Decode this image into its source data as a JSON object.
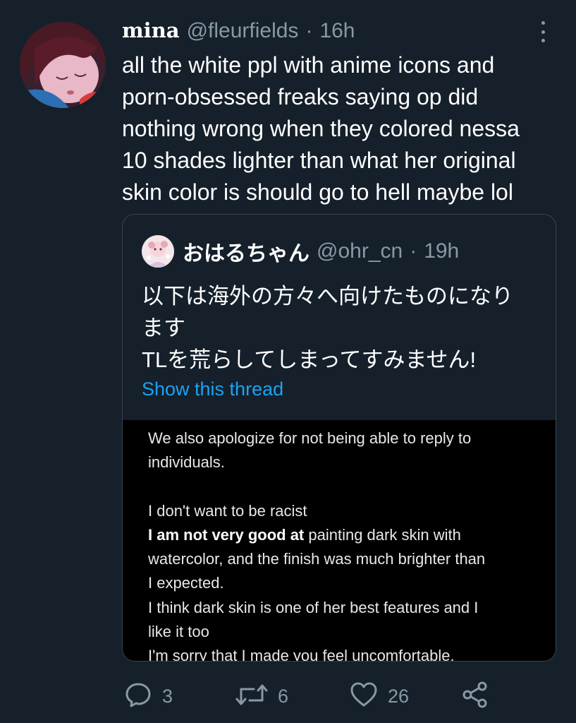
{
  "tweet": {
    "display_name": "mina",
    "handle": "@fleurfields",
    "separator": "·",
    "time": "16h",
    "text_lines": [
      "all the white ppl with anime icons and",
      "porn-obsessed freaks saying op did",
      "nothing wrong when they colored nessa",
      "10 shades lighter than what her original",
      "skin color is  should go to hell maybe lol"
    ]
  },
  "quoted_tweet": {
    "display_name": "おはるちゃん",
    "handle": "@ohr_cn",
    "separator": "·",
    "time": "19h",
    "text_lines": [
      "以下は海外の方々へ向けたものになり",
      "ます",
      "TLを荒らしてしまってすみません!"
    ],
    "show_thread": "Show this thread",
    "image_text": {
      "line1": "We also apologize for not being able to reply to",
      "line2": "individuals.",
      "line3": "",
      "line4": "I don't want to be racist",
      "line5_bold": "I am not very good at",
      "line5_rest": " painting dark skin with",
      "line6": "watercolor, and the finish was much brighter than",
      "line7": "I expected.",
      "line8": "I think dark skin is one of her best features and I",
      "line9": "like it too",
      "line10": "I'm sorry that I made you feel uncomfortable."
    }
  },
  "actions": {
    "replies": "3",
    "retweets": "6",
    "likes": "26",
    "icons": [
      "reply-icon",
      "retweet-icon",
      "like-icon",
      "share-icon"
    ]
  },
  "colors": {
    "background": "#15202b",
    "secondary_text": "#8899a6",
    "link": "#1da1f2",
    "border": "#38444d"
  }
}
